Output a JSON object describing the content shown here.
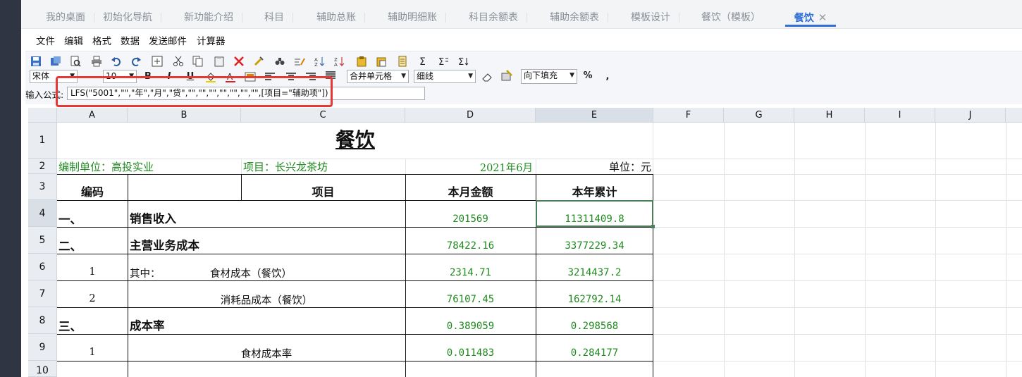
{
  "tabs": [
    {
      "label": "我的桌面"
    },
    {
      "label": "初始化导航"
    },
    {
      "label": "新功能介绍"
    },
    {
      "label": "科目"
    },
    {
      "label": "辅助总账"
    },
    {
      "label": "辅助明细账"
    },
    {
      "label": "科目余额表"
    },
    {
      "label": "辅助余额表"
    },
    {
      "label": "模板设计"
    },
    {
      "label": "餐饮（模板）"
    },
    {
      "label": "餐饮",
      "close": "✕"
    }
  ],
  "menu": {
    "items": [
      "文件",
      "编辑",
      "格式",
      "数据",
      "发送邮件",
      "计算器"
    ]
  },
  "toolbar": {
    "font_name": "宋体",
    "font_size": "10",
    "merge_select": "合并单元格",
    "border_select": "细线",
    "fill_select": "向下填充",
    "percent": "%",
    "comma": ","
  },
  "formula": {
    "label": "输入公式:",
    "value": "LFS(\"5001\",\"\",\"年\",\"月\",\"贷\",\"\",\"\",\"\",\"\",\"\",\"\",\"\",[项目=\"辅助项\"])"
  },
  "columns": [
    "A",
    "B",
    "C",
    "D",
    "E",
    "F",
    "G",
    "H",
    "I",
    "J"
  ],
  "rows": [
    "1",
    "2",
    "3",
    "4",
    "5",
    "6",
    "7",
    "8",
    "9",
    "10"
  ],
  "sheet": {
    "title": "餐饮",
    "r2": {
      "unit_org": "编制单位：高投实业",
      "project": "项目：长兴龙茶坊",
      "period": "2021年6月",
      "unit": "单位：元"
    },
    "r3": {
      "code": "编码",
      "item": "项目",
      "month": "本月金额",
      "year": "本年累计"
    },
    "r4": {
      "code": "一、",
      "item": "销售收入",
      "month": "201569",
      "year": "11311409.8"
    },
    "r5": {
      "code": "二、",
      "item": "主营业务成本",
      "month": "78422.16",
      "year": "3377229.34"
    },
    "r6": {
      "code": "1",
      "prefix": "其中：",
      "item": "食材成本（餐饮）",
      "month": "2314.71",
      "year": "3214437.2"
    },
    "r7": {
      "code": "2",
      "item": "消耗品成本（餐饮）",
      "month": "76107.45",
      "year": "162792.14"
    },
    "r8": {
      "code": "三、",
      "item": "成本率",
      "month": "0.389059",
      "year": "0.298568"
    },
    "r9": {
      "code": "1",
      "item": "食材成本率",
      "month": "0.011483",
      "year": "0.284177"
    }
  }
}
